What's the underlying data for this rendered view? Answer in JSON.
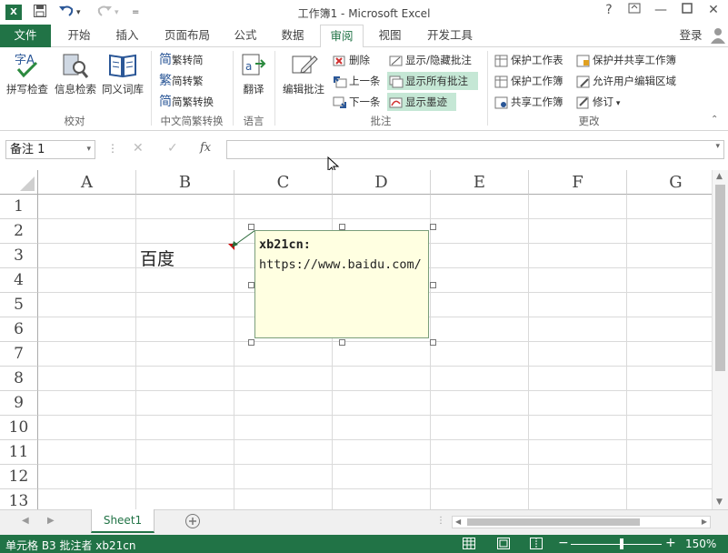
{
  "window": {
    "title": "工作簿1 - Microsoft Excel",
    "help": "?",
    "login": "登录"
  },
  "tabs": [
    {
      "label": "文件"
    },
    {
      "label": "开始"
    },
    {
      "label": "插入"
    },
    {
      "label": "页面布局"
    },
    {
      "label": "公式"
    },
    {
      "label": "数据"
    },
    {
      "label": "审阅"
    },
    {
      "label": "视图"
    },
    {
      "label": "开发工具"
    }
  ],
  "ribbon": {
    "proofing": {
      "group_label": "校对",
      "spell": "拼写检查",
      "research": "信息检索",
      "thesaurus": "同义词库"
    },
    "chinese": {
      "group_label": "中文简繁转换",
      "t2s": "繁转简",
      "s2t": "简转繁",
      "convert": "简繁转换"
    },
    "language": {
      "group_label": "语言",
      "translate": "翻译"
    },
    "comments": {
      "group_label": "批注",
      "edit": "编辑批注",
      "delete": "删除",
      "prev": "上一条",
      "next": "下一条",
      "show_hide": "显示/隐藏批注",
      "show_all": "显示所有批注",
      "show_ink": "显示墨迹"
    },
    "changes": {
      "group_label": "更改",
      "protect_sheet": "保护工作表",
      "protect_book": "保护工作簿",
      "share_book": "共享工作簿",
      "protect_share": "保护并共享工作簿",
      "allow_edit": "允许用户编辑区域",
      "track": "修订"
    }
  },
  "formula_bar": {
    "name_box": "备注 1",
    "fx": "fx",
    "content": ""
  },
  "columns": [
    "A",
    "B",
    "C",
    "D",
    "E",
    "F",
    "G"
  ],
  "rows": [
    "1",
    "2",
    "3",
    "4",
    "5",
    "6",
    "7",
    "8",
    "9",
    "10",
    "11",
    "12",
    "13"
  ],
  "cells": {
    "B3": "百度"
  },
  "comment": {
    "author": "xb21cn:",
    "text": "https://www.baidu.com/"
  },
  "sheet_tabs": [
    {
      "label": "Sheet1"
    }
  ],
  "status": {
    "text": "单元格 B3 批注者 xb21cn",
    "zoom": "150%"
  },
  "colors": {
    "accent": "#217346",
    "comment_bg": "#ffffe1",
    "highlight": "#c5e7d5"
  }
}
